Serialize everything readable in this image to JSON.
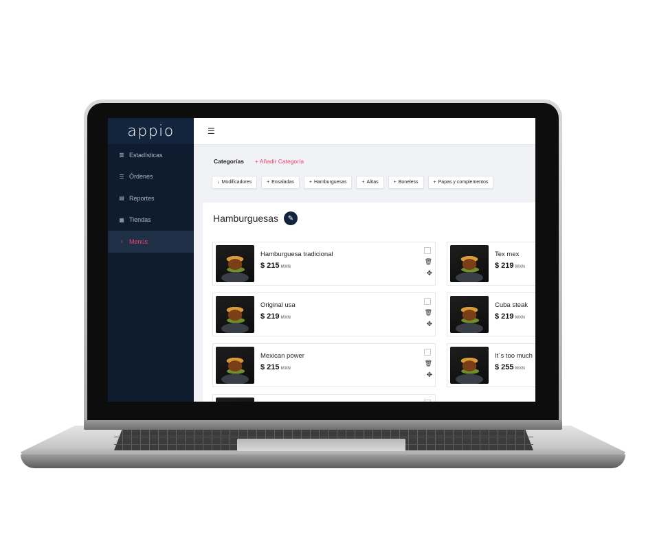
{
  "app": {
    "logo": "appio"
  },
  "sidebar": {
    "items": [
      {
        "label": "Estadísticas",
        "icon": "bar-chart-icon",
        "glyph": "▥"
      },
      {
        "label": "Órdenes",
        "icon": "list-icon",
        "glyph": "☰"
      },
      {
        "label": "Reportes",
        "icon": "document-icon",
        "glyph": "▤"
      },
      {
        "label": "Tiendas",
        "icon": "store-icon",
        "glyph": "▦"
      },
      {
        "label": "Menús",
        "icon": "menu-icon",
        "glyph": "♁",
        "active": true
      }
    ]
  },
  "header": {
    "menu_toggle_glyph": "☰"
  },
  "categories": {
    "title": "Categorías",
    "add_label": "+ Añadir Categoría",
    "chips": [
      {
        "label": "Modificadores",
        "glyph": "↓"
      },
      {
        "label": "Ensaladas",
        "glyph": "+"
      },
      {
        "label": "Hamburguesas",
        "glyph": "+"
      },
      {
        "label": "Alitas",
        "glyph": "+"
      },
      {
        "label": "Boneless",
        "glyph": "+"
      },
      {
        "label": "Papas y complementos",
        "glyph": "+"
      }
    ]
  },
  "section": {
    "title": "Hamburguesas",
    "edit_glyph": "✎"
  },
  "products": [
    {
      "name": "Hamburguesa tradicional",
      "price": "$ 215",
      "currency": "MXN"
    },
    {
      "name": "Tex mex",
      "price": "$ 219",
      "currency": "MXN"
    },
    {
      "name": "Original usa",
      "price": "$ 219",
      "currency": "MXN"
    },
    {
      "name": "Cuba steak",
      "price": "$ 219",
      "currency": "MXN"
    },
    {
      "name": "Mexican power",
      "price": "$ 215",
      "currency": "MXN"
    },
    {
      "name": "It´s too much",
      "price": "$ 255",
      "currency": "MXN"
    }
  ],
  "icons": {
    "trash": "🗑",
    "move": "✥"
  },
  "colors": {
    "sidebar": "#0f1c30",
    "accent": "#f0426b",
    "dark_button": "#13253d"
  }
}
